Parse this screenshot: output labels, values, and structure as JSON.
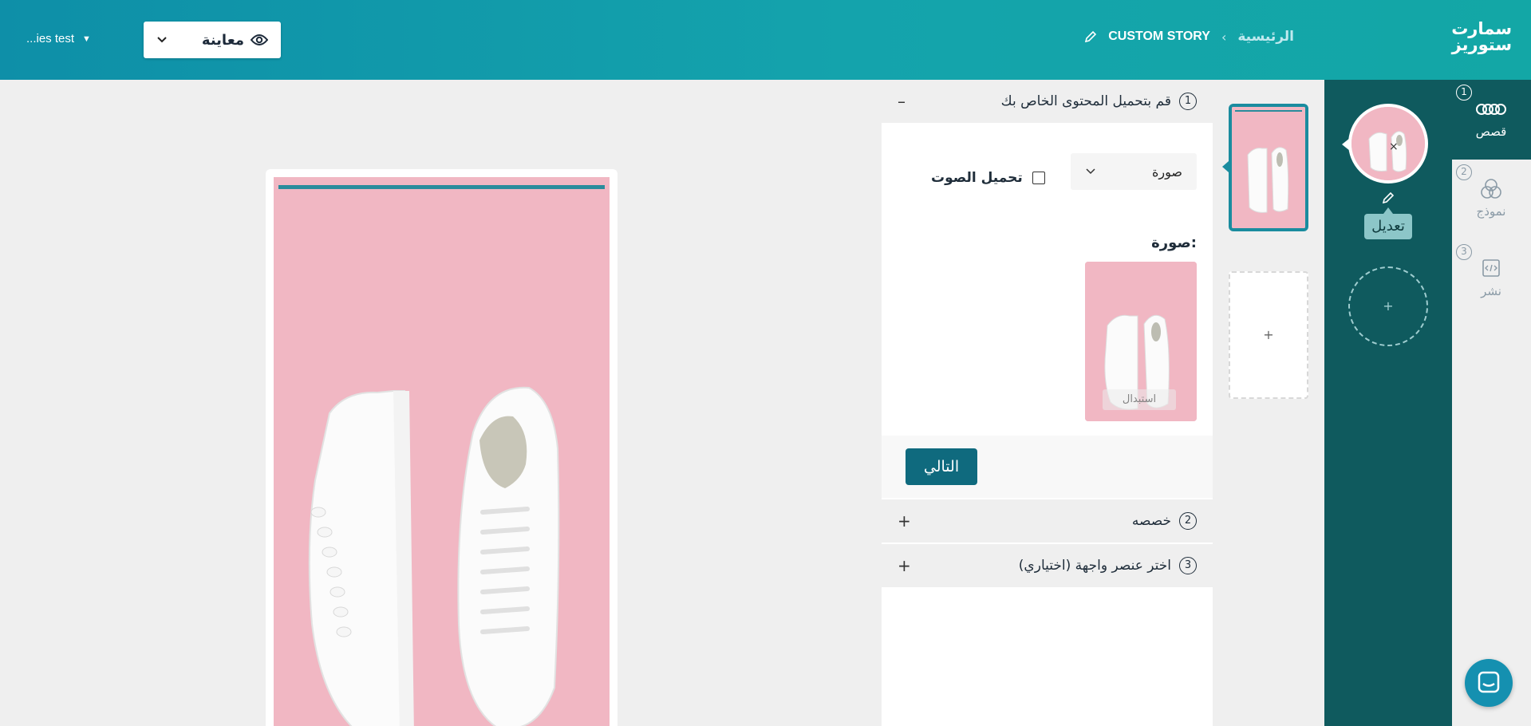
{
  "header": {
    "logo_line1": "سمارت",
    "logo_line2": "ستوريز",
    "breadcrumb_home": "الرئيسية",
    "breadcrumb_current": "CUSTOM STORY",
    "preview_label": "معاينة",
    "user_name": "...ies test"
  },
  "nav": {
    "items": [
      {
        "num": "1",
        "label": "قصص",
        "icon": "stories-icon"
      },
      {
        "num": "2",
        "label": "نموذج",
        "icon": "template-icon"
      },
      {
        "num": "3",
        "label": "نشر",
        "icon": "publish-code-icon"
      }
    ]
  },
  "stories": {
    "edit_label": "تعديل",
    "close": "×",
    "add": "+"
  },
  "slides": {
    "add": "+"
  },
  "form": {
    "section1": {
      "num": "1",
      "title": "قم بتحميل المحتوى الخاص بك",
      "toggle": "–"
    },
    "type_select_value": "صورة",
    "audio_label": "تحميل الصوت",
    "image_label": "صورة:",
    "replace_label": "استبدال",
    "next_label": "التالي",
    "section2": {
      "num": "2",
      "title": "خصصه",
      "toggle": "+"
    },
    "section3": {
      "num": "3",
      "title": "اختر عنصر واجهة (اختياري)",
      "toggle": "+"
    }
  },
  "colors": {
    "accent": "#0f5a5e",
    "header_start": "#0e8fa8",
    "header_end": "#13a7a6",
    "next_button": "#0f6a7e",
    "story_bg": "#f1b7c3"
  }
}
